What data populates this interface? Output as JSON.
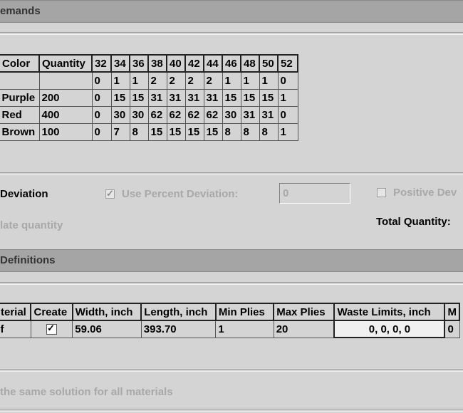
{
  "demands_section": {
    "title": "emands",
    "headers": [
      "Color",
      "Quantity",
      "32",
      "34",
      "36",
      "38",
      "40",
      "42",
      "44",
      "46",
      "48",
      "50",
      "52"
    ],
    "ratio_row": [
      "",
      "",
      "0",
      "1",
      "1",
      "2",
      "2",
      "2",
      "2",
      "1",
      "1",
      "1",
      "0"
    ],
    "rows": [
      [
        "Purple",
        "200",
        "0",
        "15",
        "15",
        "31",
        "31",
        "31",
        "31",
        "15",
        "15",
        "15",
        "1"
      ],
      [
        "Red",
        "400",
        "0",
        "30",
        "30",
        "62",
        "62",
        "62",
        "62",
        "30",
        "31",
        "31",
        "0"
      ],
      [
        "Brown",
        "100",
        "0",
        "7",
        "8",
        "15",
        "15",
        "15",
        "15",
        "8",
        "8",
        "8",
        "1"
      ]
    ]
  },
  "deviation": {
    "label": "Deviation",
    "use_percent_label": "Use Percent Deviation:",
    "use_percent_checked": true,
    "percent_value": "0",
    "positive_label": "Positive Dev",
    "positive_checked": false,
    "calc_quantity_label": "late quantity",
    "total_quantity_label": "Total Quantity:"
  },
  "definitions_section": {
    "title": "Definitions",
    "headers": [
      "terial",
      "Create",
      "Width, inch",
      "Length, inch",
      "Min Plies",
      "Max Plies",
      "Waste Limits, inch",
      "M"
    ],
    "row": {
      "material": "f",
      "create_checked": true,
      "width": "59.06",
      "length": "393.70",
      "min_plies": "1",
      "max_plies": "20",
      "waste_limits": "0, 0, 0, 0",
      "extra": "0"
    },
    "same_solution_label": "the same solution for all materials"
  }
}
